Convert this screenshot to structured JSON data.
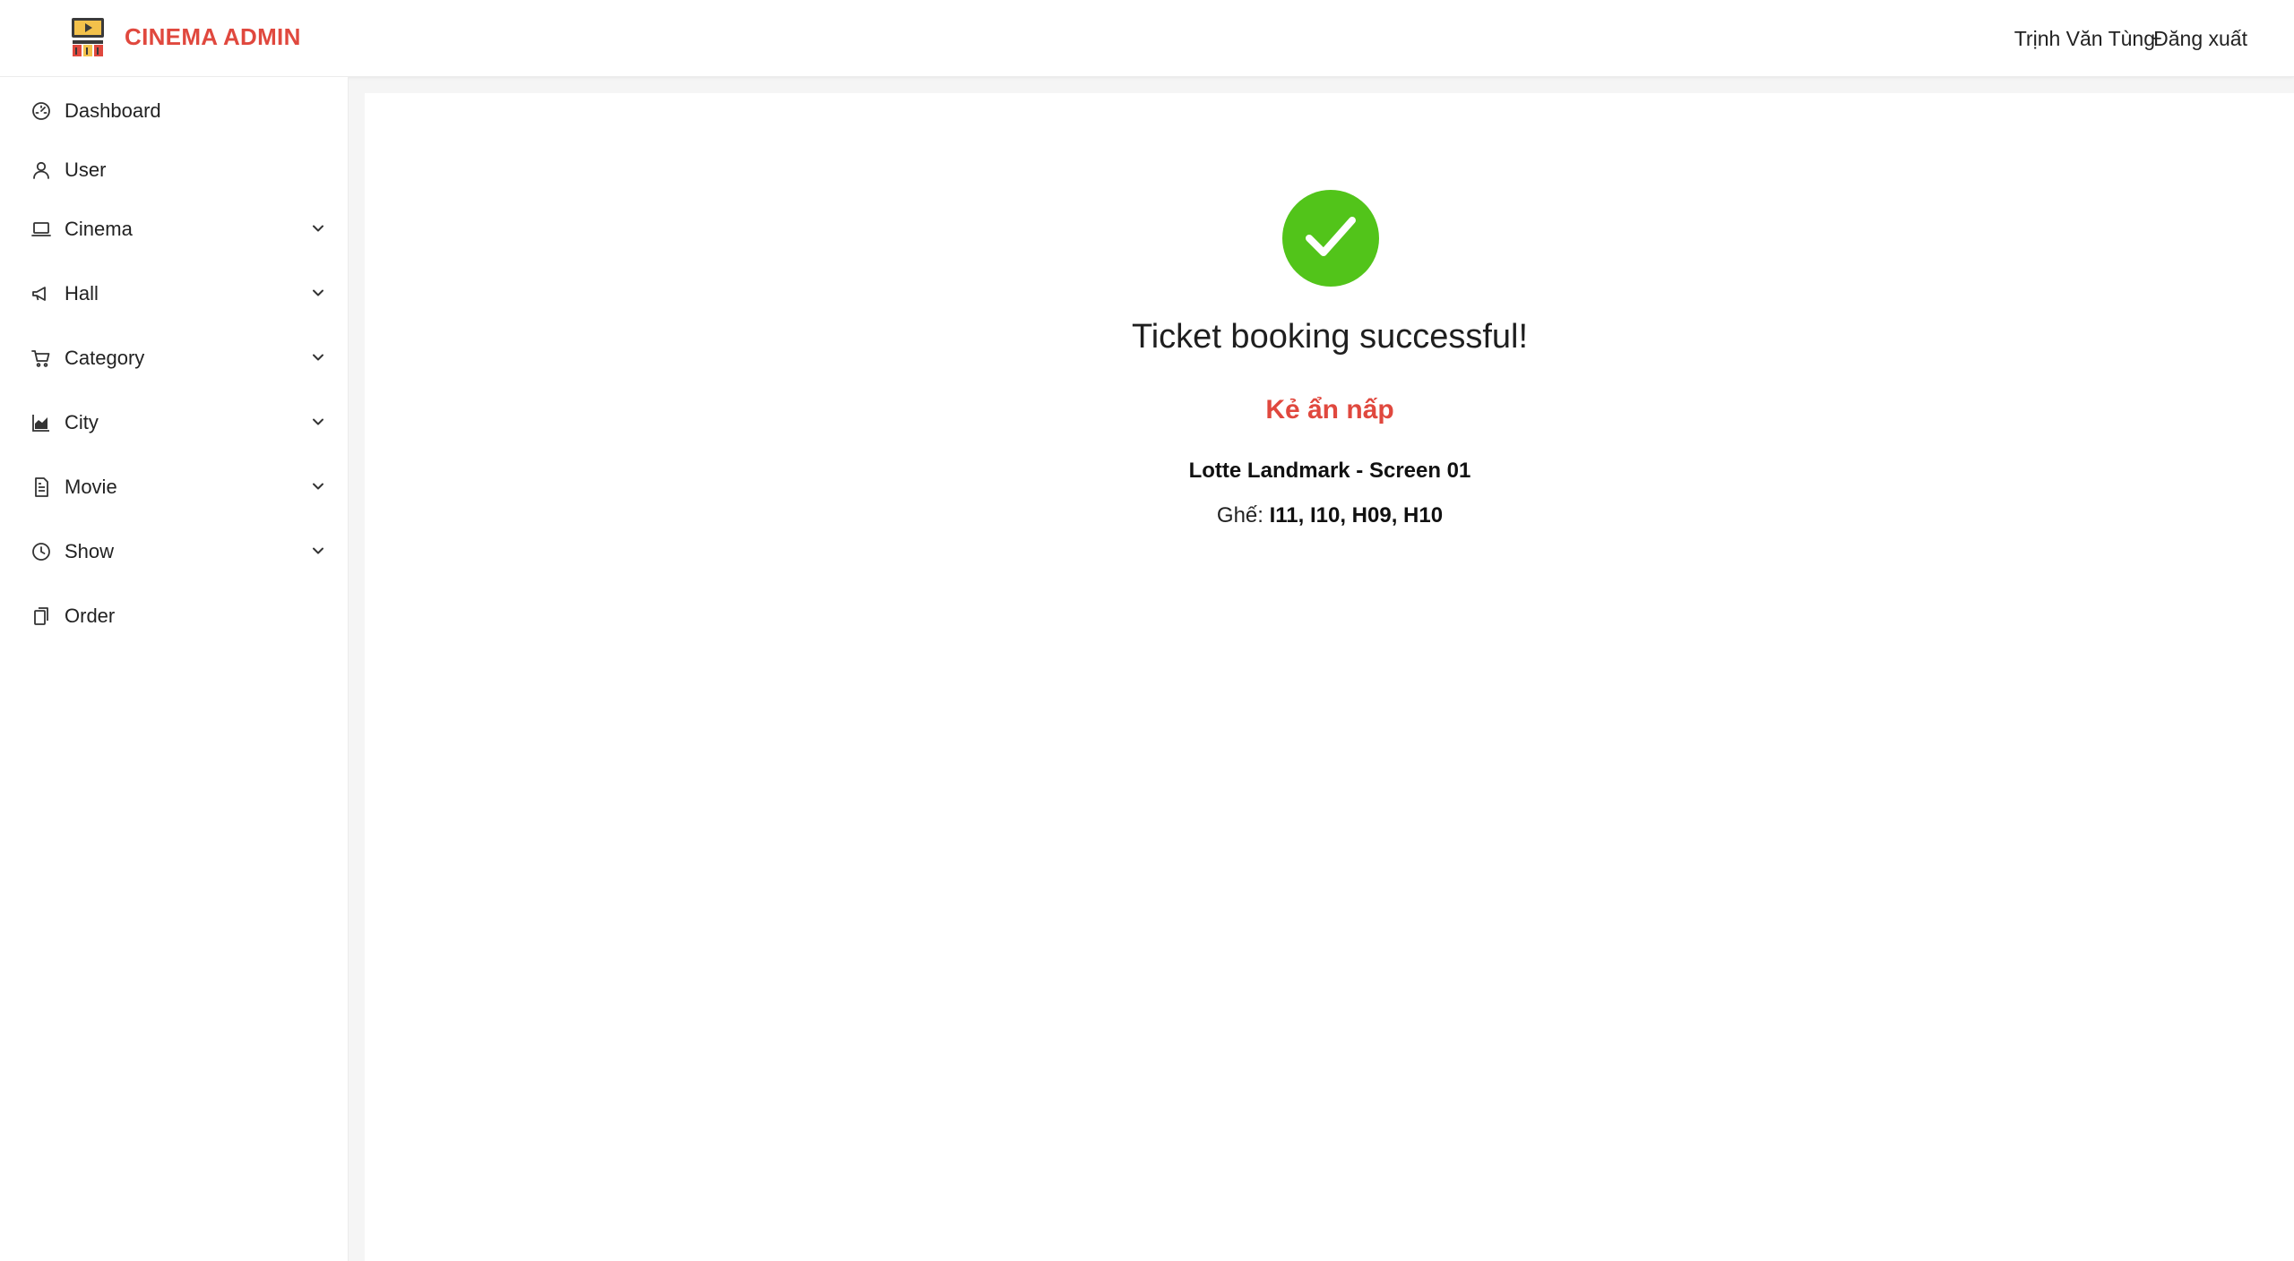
{
  "header": {
    "brand": "CINEMA ADMIN",
    "brand_color": "#e0483e",
    "logo_icon": "cinema-clapper-icon",
    "user_name": "Trịnh Văn Tùng",
    "logout_label": "Đăng xuất"
  },
  "sidebar": {
    "items": [
      {
        "label": "Dashboard",
        "icon": "dashboard-gauge-icon",
        "expandable": false
      },
      {
        "label": "User",
        "icon": "user-icon",
        "expandable": false
      },
      {
        "label": "Cinema",
        "icon": "laptop-icon",
        "expandable": true
      },
      {
        "label": "Hall",
        "icon": "megaphone-icon",
        "expandable": true
      },
      {
        "label": "Category",
        "icon": "shopping-cart-icon",
        "expandable": true
      },
      {
        "label": "City",
        "icon": "area-chart-icon",
        "expandable": true
      },
      {
        "label": "Movie",
        "icon": "document-icon",
        "expandable": true
      },
      {
        "label": "Show",
        "icon": "clock-icon",
        "expandable": true
      },
      {
        "label": "Order",
        "icon": "copy-icon",
        "expandable": false
      }
    ]
  },
  "result": {
    "status": "success",
    "status_icon": "check-circle-icon",
    "status_color": "#52c41a",
    "title": "Ticket booking successful!",
    "movie_name": "Kẻ ẩn nấp",
    "movie_color": "#e0483e",
    "cinema_screen": "Lotte Landmark - Screen 01",
    "seats_label": "Ghế: ",
    "seats": "I11, I10, H09, H10"
  }
}
